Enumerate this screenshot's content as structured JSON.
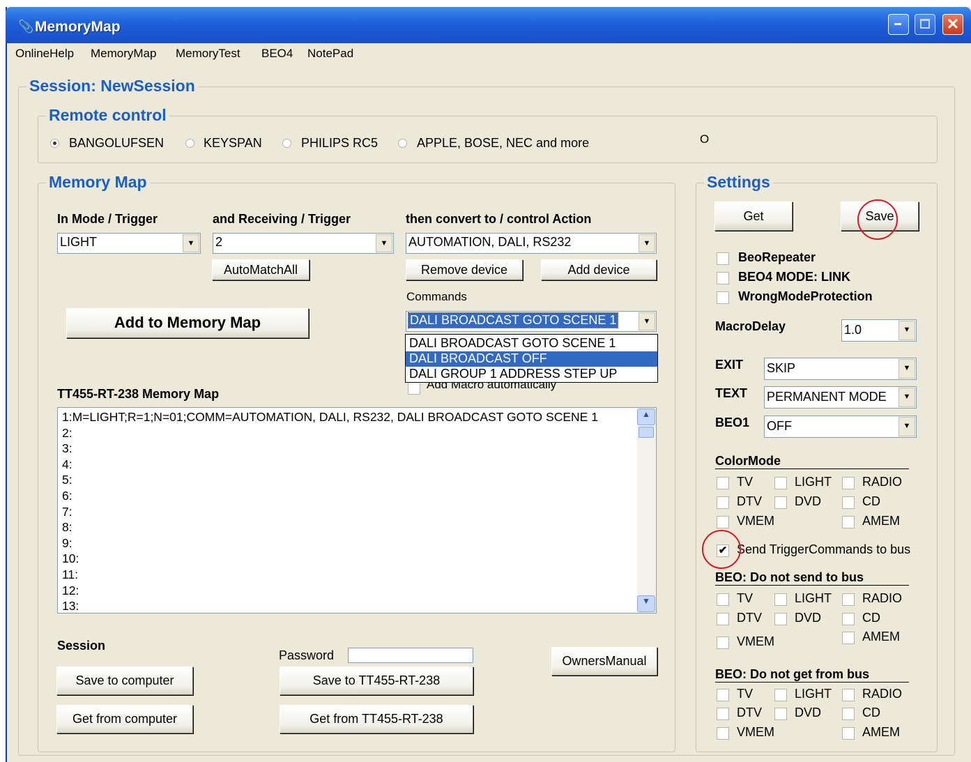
{
  "window": {
    "title": "MemoryMap",
    "min": "_",
    "max": "□",
    "close": "X"
  },
  "menu": [
    "OnlineHelp",
    "MemoryMap",
    "MemoryTest",
    "BEO4",
    "NotePad"
  ],
  "session": {
    "title": "Session: NewSession"
  },
  "remote": {
    "title": "Remote control",
    "options": [
      "BANGOLUFSEN",
      "KEYSPAN",
      "PHILIPS RC5",
      "APPLE, BOSE, NEC and more"
    ],
    "selected": "BANGOLUFSEN",
    "indicator": "O"
  },
  "memmap": {
    "title": "Memory Map",
    "mode_label": "In Mode / Trigger",
    "mode_value": "LIGHT",
    "recv_label": "and Receiving / Trigger",
    "recv_value": "2",
    "action_label": "then convert to / control Action",
    "action_value": "AUTOMATION, DALI, RS232",
    "automatch": "AutoMatchAll",
    "remove_device": "Remove device",
    "add_device": "Add device",
    "commands_label": "Commands",
    "commands_value": "DALI BROADCAST GOTO SCENE 1",
    "commands_options": [
      "DALI BROADCAST GOTO SCENE 1",
      "DALI BROADCAST OFF",
      "DALI GROUP 1 ADDRESS STEP UP"
    ],
    "commands_highlighted": "DALI BROADCAST OFF",
    "add_macro": "Add Macro automatically",
    "add_button": "Add to Memory Map",
    "list_title": "TT455-RT-238 Memory Map",
    "lines": [
      "1:M=LIGHT;R=1;N=01;COMM=AUTOMATION, DALI, RS232, DALI BROADCAST GOTO SCENE 1",
      "2:",
      "3:",
      "4:",
      "5:",
      "6:",
      "7:",
      "8:",
      "9:",
      "10:",
      "11:",
      "12:",
      "13:"
    ]
  },
  "bottom": {
    "session_label": "Session",
    "save_computer": "Save to computer",
    "get_computer": "Get from computer",
    "password_label": "Password",
    "password_value": "",
    "save_device": "Save to TT455-RT-238",
    "get_device": "Get from TT455-RT-238",
    "owners_manual": "OwnersManual"
  },
  "settings": {
    "title": "Settings",
    "get": "Get",
    "save": "Save",
    "beorepeater": "BeoRepeater",
    "beo4_mode": "BEO4 MODE: LINK",
    "wrongmode": "WrongModeProtection",
    "macrodelay_label": "MacroDelay",
    "macrodelay_value": "1.0",
    "exit_label": "EXIT",
    "exit_value": "SKIP",
    "text_label": "TEXT",
    "text_value": "PERMANENT MODE",
    "beo1_label": "BEO1",
    "beo1_value": "OFF",
    "colormode_title": "ColorMode",
    "send_trigger": "Send TriggerCommands to bus",
    "send_trigger_checked": true,
    "no_send_title": "BEO: Do not send to bus",
    "no_get_title": "BEO: Do not get from bus",
    "sources": {
      "tv": "TV",
      "light": "LIGHT",
      "radio": "RADIO",
      "dtv": "DTV",
      "dvd": "DVD",
      "cd": "CD",
      "vmem": "VMEM",
      "amem": "AMEM"
    }
  }
}
